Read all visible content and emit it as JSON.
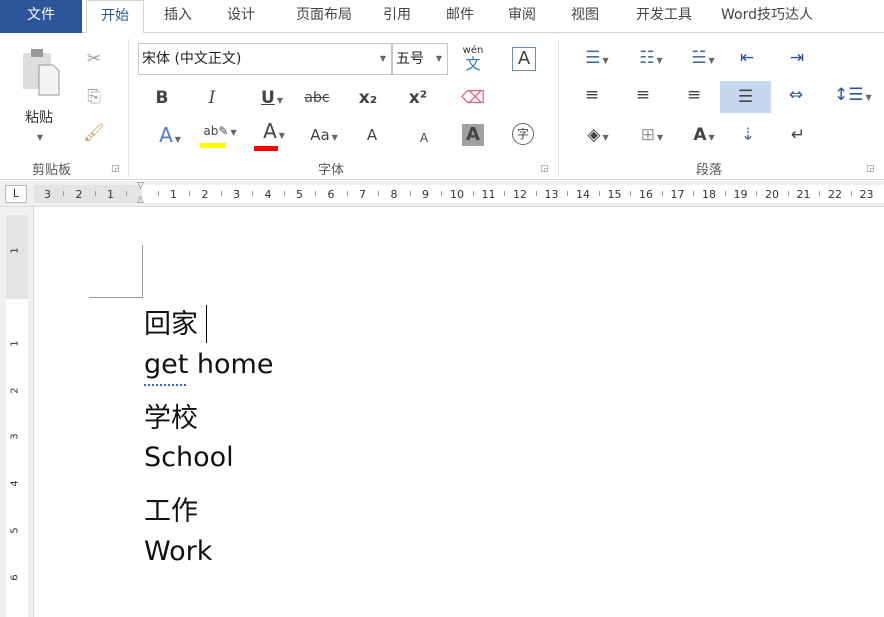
{
  "tabs": [
    "文件",
    "开始",
    "插入",
    "设计",
    "页面布局",
    "引用",
    "邮件",
    "审阅",
    "视图",
    "开发工具",
    "Word技巧达人"
  ],
  "active_tab": "开始",
  "clipboard": {
    "paste_label": "粘贴",
    "group_label": "剪贴板"
  },
  "font": {
    "font_name": "宋体 (中文正文)",
    "font_size": "五号",
    "group_label": "字体",
    "bold": "B",
    "italic": "I",
    "underline": "U",
    "strikethrough": "abc",
    "subscript": "x₂",
    "superscript": "x²",
    "phonetic": "wén",
    "phonetic_char": "文",
    "border_char": "A",
    "change_case": "Aa",
    "grow": "A",
    "shrink": "A",
    "shading_char": "A",
    "enclose_char": "字",
    "highlight_color": "#ffff00",
    "font_color": "#ff0000"
  },
  "paragraph": {
    "group_label": "段落"
  },
  "ruler": {
    "corner": "L",
    "left": [
      "3",
      "2",
      "1"
    ],
    "right": [
      "1",
      "2",
      "3",
      "4",
      "5",
      "6",
      "7",
      "8",
      "9",
      "10",
      "11",
      "12",
      "13",
      "14",
      "15",
      "16",
      "17",
      "18",
      "19",
      "20",
      "21",
      "22",
      "23"
    ],
    "vertical_top": [
      "1"
    ],
    "vertical": [
      "1",
      "2",
      "3",
      "4",
      "5",
      "6"
    ]
  },
  "document": {
    "lines": [
      "回家",
      "get home",
      "学校",
      "School",
      "工作",
      "Work"
    ]
  }
}
